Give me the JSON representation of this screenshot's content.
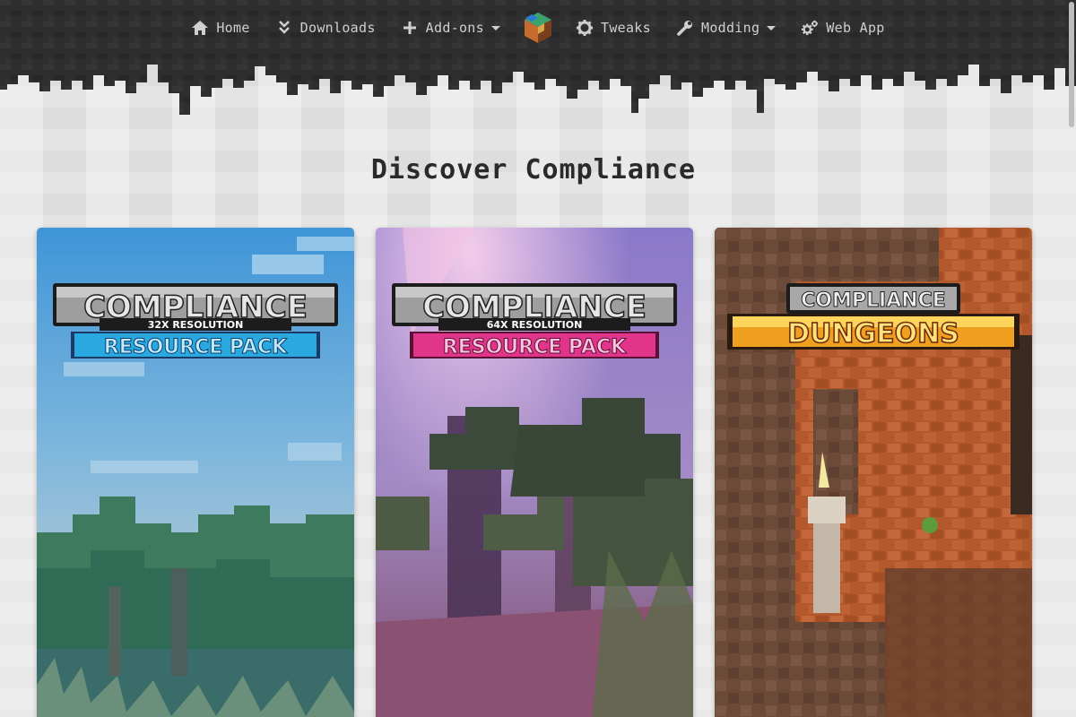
{
  "nav": {
    "items": [
      {
        "label": "Home",
        "icon": "home-icon",
        "dropdown": false
      },
      {
        "label": "Downloads",
        "icon": "double-chevron-down-icon",
        "dropdown": false
      },
      {
        "label": "Add-ons",
        "icon": "plus-icon",
        "dropdown": true
      },
      {
        "label": "Tweaks",
        "icon": "gear-icon",
        "dropdown": false
      },
      {
        "label": "Modding",
        "icon": "wrench-icon",
        "dropdown": true
      },
      {
        "label": "Web App",
        "icon": "cogs-icon",
        "dropdown": false
      }
    ],
    "logo": "compliance-logo-icon"
  },
  "page": {
    "title": "Discover Compliance"
  },
  "cards": [
    {
      "line1": "COMPLIANCE",
      "line2": "32X RESOLUTION",
      "line3": "RESOURCE PACK",
      "accent": "#2aa9e0"
    },
    {
      "line1": "COMPLIANCE",
      "line2": "64X RESOLUTION",
      "line3": "RESOURCE PACK",
      "accent": "#e0358a"
    },
    {
      "line1": "COMPLIANCE",
      "line2": "DUNGEONS",
      "accent": "#f0a020"
    }
  ],
  "colors": {
    "nav_bg": "#2b2b2b",
    "page_bg": "#e4e4e4",
    "nav_text": "#cfcfcf",
    "title_text": "#2a2a2a"
  }
}
